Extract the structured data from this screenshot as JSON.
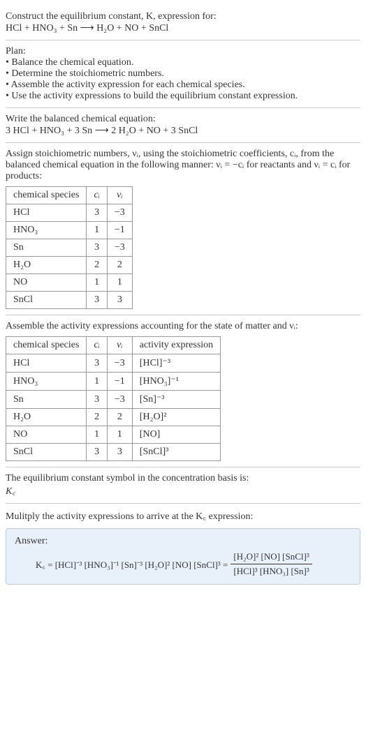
{
  "s1": {
    "l1": "Construct the equilibrium constant, K, expression for:",
    "l2": "HCl + HNO₃ + Sn ⟶ H₂O + NO + SnCl"
  },
  "s2": {
    "l1": "Plan:",
    "b1": "• Balance the chemical equation.",
    "b2": "• Determine the stoichiometric numbers.",
    "b3": "• Assemble the activity expression for each chemical species.",
    "b4": "• Use the activity expressions to build the equilibrium constant expression."
  },
  "s3": {
    "l1": "Write the balanced chemical equation:",
    "l2": "3 HCl + HNO₃ + 3 Sn ⟶ 2 H₂O + NO + 3 SnCl"
  },
  "s4": {
    "intro1": "Assign stoichiometric numbers, νᵢ, using the stoichiometric coefficients, cᵢ, from the balanced chemical equation in the following manner: νᵢ = −cᵢ for reactants and νᵢ = cᵢ for products:",
    "h1": "chemical species",
    "h2": "cᵢ",
    "h3": "νᵢ",
    "rows": [
      {
        "sp": "HCl",
        "c": "3",
        "v": "−3"
      },
      {
        "sp": "HNO₃",
        "c": "1",
        "v": "−1"
      },
      {
        "sp": "Sn",
        "c": "3",
        "v": "−3"
      },
      {
        "sp": "H₂O",
        "c": "2",
        "v": "2"
      },
      {
        "sp": "NO",
        "c": "1",
        "v": "1"
      },
      {
        "sp": "SnCl",
        "c": "3",
        "v": "3"
      }
    ]
  },
  "s5": {
    "intro": "Assemble the activity expressions accounting for the state of matter and νᵢ:",
    "h1": "chemical species",
    "h2": "cᵢ",
    "h3": "νᵢ",
    "h4": "activity expression",
    "rows": [
      {
        "sp": "HCl",
        "c": "3",
        "v": "−3",
        "a": "[HCl]⁻³"
      },
      {
        "sp": "HNO₃",
        "c": "1",
        "v": "−1",
        "a": "[HNO₃]⁻¹"
      },
      {
        "sp": "Sn",
        "c": "3",
        "v": "−3",
        "a": "[Sn]⁻³"
      },
      {
        "sp": "H₂O",
        "c": "2",
        "v": "2",
        "a": "[H₂O]²"
      },
      {
        "sp": "NO",
        "c": "1",
        "v": "1",
        "a": "[NO]"
      },
      {
        "sp": "SnCl",
        "c": "3",
        "v": "3",
        "a": "[SnCl]³"
      }
    ]
  },
  "s6": {
    "l1": "The equilibrium constant symbol in the concentration basis is:",
    "l2": "K꜀"
  },
  "s7": {
    "l1": "Mulitply the activity expressions to arrive at the K꜀ expression:",
    "answer_label": "Answer:",
    "lhs": "K꜀ = [HCl]⁻³ [HNO₃]⁻¹ [Sn]⁻³ [H₂O]² [NO] [SnCl]³ = ",
    "num": "[H₂O]² [NO] [SnCl]³",
    "den": "[HCl]³ [HNO₃] [Sn]³"
  }
}
